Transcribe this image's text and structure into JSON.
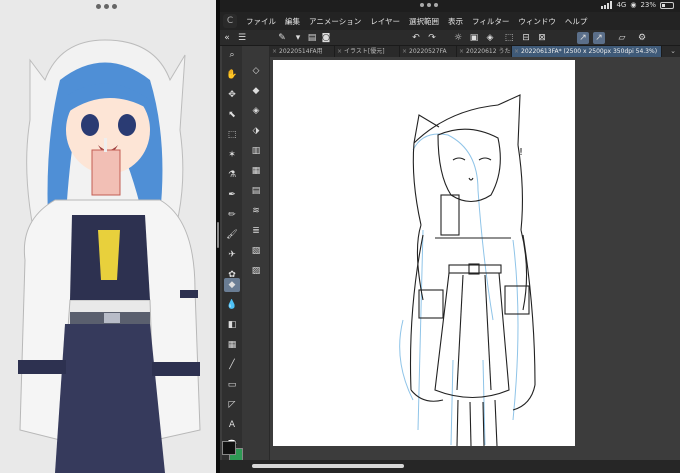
{
  "status": {
    "carrier": "4G",
    "battery": "23%"
  },
  "menu": [
    "ファイル",
    "編集",
    "アニメーション",
    "レイヤー",
    "選択範囲",
    "表示",
    "フィルター",
    "ウィンドウ",
    "ヘルプ"
  ],
  "tabs": [
    {
      "label": "20220514FA用",
      "active": false
    },
    {
      "label": "イラスト[優元]",
      "active": false
    },
    {
      "label": "20220527FA",
      "active": false
    },
    {
      "label": "20220612 うた",
      "active": false
    },
    {
      "label": "20220613FA* (2500 x 2500px 350dpi 54.3%)",
      "active": true
    }
  ],
  "tab_dropdown": "⌄",
  "palette": {
    "accent": "#5b6f8a",
    "active_tab": "#3f5a78",
    "foreground_color": "#111111",
    "background_color": "#2e9a55"
  },
  "icons": {
    "toolbar": [
      "menu-icon",
      "new-icon",
      "open-icon",
      "save-icon",
      "undo-icon",
      "redo-icon",
      "clear-icon",
      "transform-icon",
      "fill-icon",
      "deselect-icon",
      "crop-icon",
      "show-selection-icon",
      "snap-ruler-icon",
      "snap-special-icon",
      "snap-grid-icon",
      "settings-icon"
    ]
  },
  "canvas_annotation": "!"
}
